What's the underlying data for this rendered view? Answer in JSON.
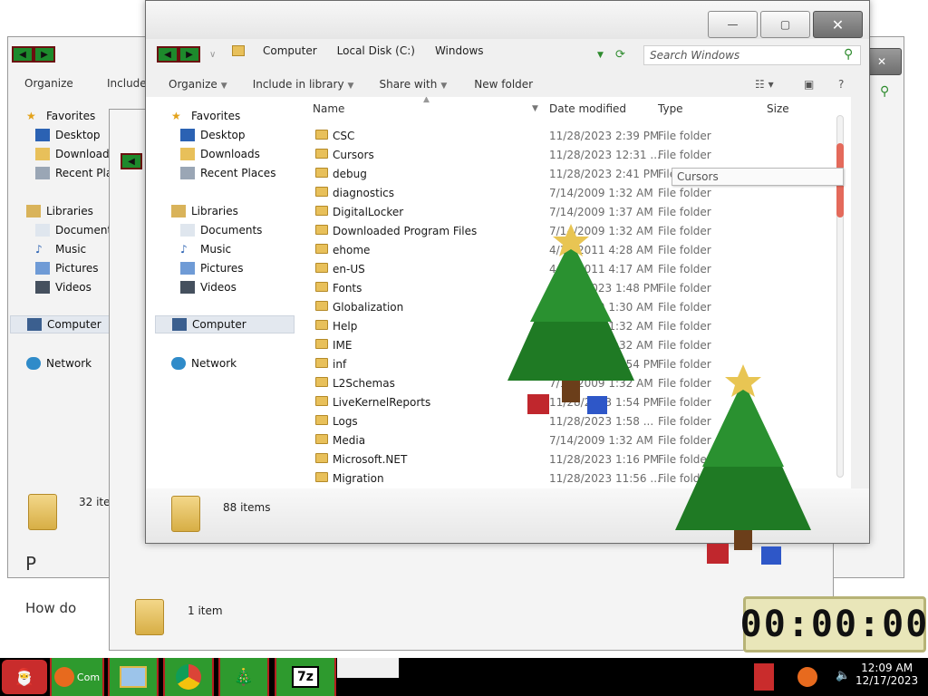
{
  "window": {
    "address": {
      "computer": "Computer",
      "drive": "Local Disk (C:)",
      "folder": "Windows"
    },
    "search_placeholder": "Search Windows",
    "toolbar": {
      "organize": "Organize",
      "include": "Include in library",
      "share": "Share with",
      "newfolder": "New folder"
    },
    "columns": {
      "name": "Name",
      "date": "Date modified",
      "type": "Type",
      "size": "Size"
    },
    "nav": {
      "favorites": "Favorites",
      "desktop": "Desktop",
      "downloads": "Downloads",
      "recent": "Recent Places",
      "libraries": "Libraries",
      "documents": "Documents",
      "music": "Music",
      "pictures": "Pictures",
      "videos": "Videos",
      "computer": "Computer",
      "network": "Network"
    },
    "tooltip": "Cursors",
    "status": "88 items",
    "files": [
      {
        "name": "CSC",
        "date": "11/28/2023 2:39 PM",
        "type": "File folder"
      },
      {
        "name": "Cursors",
        "date": "11/28/2023 12:31 ...",
        "type": "File folder"
      },
      {
        "name": "debug",
        "date": "11/28/2023 2:41 PM",
        "type": "File folder"
      },
      {
        "name": "diagnostics",
        "date": "7/14/2009 1:32 AM",
        "type": "File folder"
      },
      {
        "name": "DigitalLocker",
        "date": "7/14/2009 1:37 AM",
        "type": "File folder"
      },
      {
        "name": "Downloaded Program Files",
        "date": "7/14/2009 1:32 AM",
        "type": "File folder"
      },
      {
        "name": "ehome",
        "date": "4/12/2011 4:28 AM",
        "type": "File folder"
      },
      {
        "name": "en-US",
        "date": "4/12/2011 4:17 AM",
        "type": "File folder"
      },
      {
        "name": "Fonts",
        "date": "11/28/2023 1:48 PM",
        "type": "File folder"
      },
      {
        "name": "Globalization",
        "date": "7/14/2009 1:30 AM",
        "type": "File folder"
      },
      {
        "name": "Help",
        "date": "7/14/2009 1:32 AM",
        "type": "File folder"
      },
      {
        "name": "IME",
        "date": "7/14/2009 1:32 AM",
        "type": "File folder"
      },
      {
        "name": "inf",
        "date": "11/28/2023 1:54 PM",
        "type": "File folder"
      },
      {
        "name": "L2Schemas",
        "date": "7/14/2009 1:32 AM",
        "type": "File folder"
      },
      {
        "name": "LiveKernelReports",
        "date": "11/28/2023 1:54 PM",
        "type": "File folder"
      },
      {
        "name": "Logs",
        "date": "11/28/2023 1:58 ...",
        "type": "File folder"
      },
      {
        "name": "Media",
        "date": "7/14/2009 1:32 AM",
        "type": "File folder"
      },
      {
        "name": "Microsoft.NET",
        "date": "11/28/2023 1:16 PM",
        "type": "File folder"
      },
      {
        "name": "Migration",
        "date": "11/28/2023 11:56 ...",
        "type": "File folder"
      }
    ]
  },
  "back_window_1": {
    "toolbar": {
      "organize": "Organize",
      "include": "Include"
    },
    "nav": {
      "favorites": "Favorites",
      "desktop": "Desktop",
      "downloads": "Downloads",
      "recent": "Recent Plac",
      "libraries": "Libraries",
      "documents": "Documents",
      "music": "Music",
      "pictures": "Pictures",
      "videos": "Videos",
      "computer": "Computer",
      "network": "Network"
    },
    "status": "32 ite"
  },
  "back_window_2": {
    "status": "1 item"
  },
  "page_peek": {
    "letter": "P",
    "question": "How do"
  },
  "timer": "00:00:00",
  "taskbar": {
    "time": "12:09 AM",
    "date": "12/17/2023",
    "item": "Com",
    "sevenzip": "7z"
  }
}
